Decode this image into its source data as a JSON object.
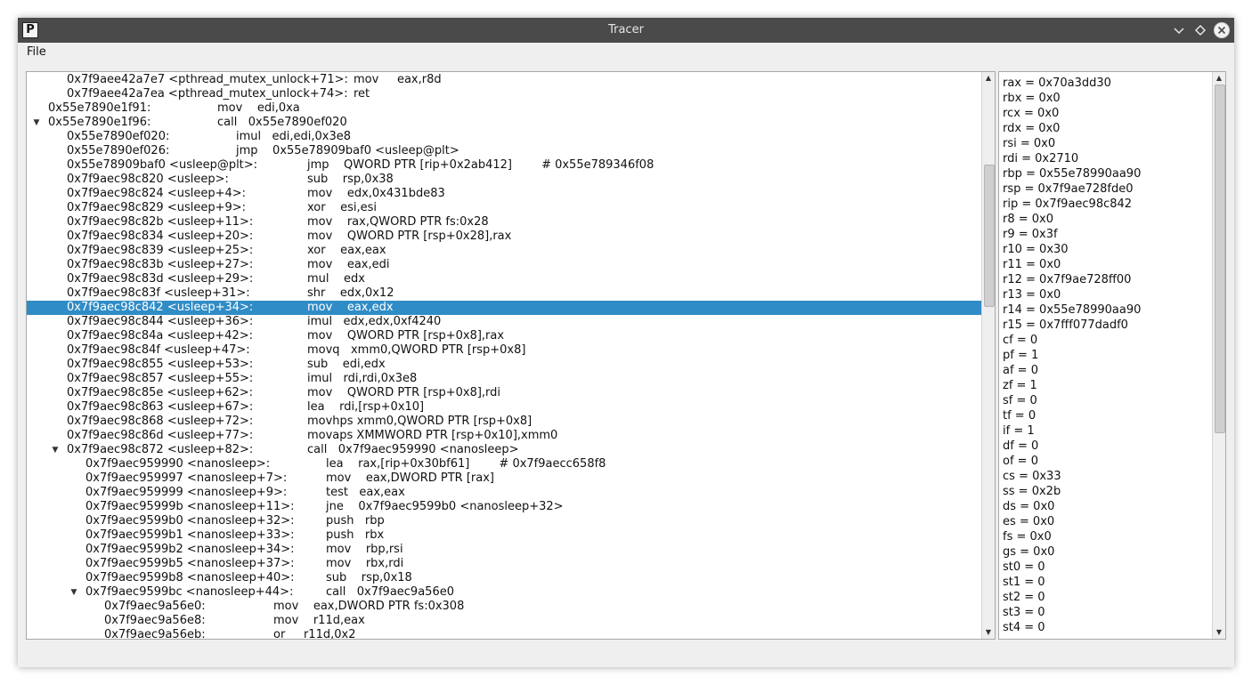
{
  "window": {
    "title": "Tracer",
    "icon_letter": "P",
    "controls": [
      "chevron-down-icon",
      "diamond-icon",
      "close-icon"
    ]
  },
  "menu": {
    "file_label": "File"
  },
  "colors": {
    "selection": "#308cc6",
    "titlebar": "#4a4a4a"
  },
  "trace": {
    "rows": [
      {
        "indent": 1,
        "arrow": "",
        "addr": "0x7f9aee42a7e7 <pthread_mutex_unlock+71>:",
        "instr": "mov     eax,r8d"
      },
      {
        "indent": 1,
        "arrow": "",
        "addr": "0x7f9aee42a7ea <pthread_mutex_unlock+74>:",
        "instr": "ret"
      },
      {
        "indent": 0,
        "arrow": "",
        "addr": "0x55e7890e1f91:",
        "instr": "mov    edi,0xa"
      },
      {
        "indent": 0,
        "arrow": "▼",
        "addr": "0x55e7890e1f96:",
        "instr": "call   0x55e7890ef020"
      },
      {
        "indent": 1,
        "arrow": "",
        "addr": "0x55e7890ef020:",
        "instr": "imul   edi,edi,0x3e8"
      },
      {
        "indent": 1,
        "arrow": "",
        "addr": "0x55e7890ef026:",
        "instr": "jmp    0x55e78909baf0 <usleep@plt>"
      },
      {
        "indent": 1,
        "arrow": "",
        "addr": "0x55e78909baf0 <usleep@plt>:",
        "instr": "jmp    QWORD PTR [rip+0x2ab412]        # 0x55e789346f08"
      },
      {
        "indent": 1,
        "arrow": "",
        "addr": "0x7f9aec98c820 <usleep>:",
        "instr": "sub    rsp,0x38"
      },
      {
        "indent": 1,
        "arrow": "",
        "addr": "0x7f9aec98c824 <usleep+4>:",
        "instr": "mov    edx,0x431bde83"
      },
      {
        "indent": 1,
        "arrow": "",
        "addr": "0x7f9aec98c829 <usleep+9>:",
        "instr": "xor    esi,esi"
      },
      {
        "indent": 1,
        "arrow": "",
        "addr": "0x7f9aec98c82b <usleep+11>:",
        "instr": "mov    rax,QWORD PTR fs:0x28"
      },
      {
        "indent": 1,
        "arrow": "",
        "addr": "0x7f9aec98c834 <usleep+20>:",
        "instr": "mov    QWORD PTR [rsp+0x28],rax"
      },
      {
        "indent": 1,
        "arrow": "",
        "addr": "0x7f9aec98c839 <usleep+25>:",
        "instr": "xor    eax,eax"
      },
      {
        "indent": 1,
        "arrow": "",
        "addr": "0x7f9aec98c83b <usleep+27>:",
        "instr": "mov    eax,edi"
      },
      {
        "indent": 1,
        "arrow": "",
        "addr": "0x7f9aec98c83d <usleep+29>:",
        "instr": "mul    edx"
      },
      {
        "indent": 1,
        "arrow": "",
        "addr": "0x7f9aec98c83f <usleep+31>:",
        "instr": "shr    edx,0x12"
      },
      {
        "indent": 1,
        "arrow": "",
        "addr": "0x7f9aec98c842 <usleep+34>:",
        "instr": "mov    eax,edx",
        "selected": true
      },
      {
        "indent": 1,
        "arrow": "",
        "addr": "0x7f9aec98c844 <usleep+36>:",
        "instr": "imul   edx,edx,0xf4240"
      },
      {
        "indent": 1,
        "arrow": "",
        "addr": "0x7f9aec98c84a <usleep+42>:",
        "instr": "mov    QWORD PTR [rsp+0x8],rax"
      },
      {
        "indent": 1,
        "arrow": "",
        "addr": "0x7f9aec98c84f <usleep+47>:",
        "instr": "movq   xmm0,QWORD PTR [rsp+0x8]"
      },
      {
        "indent": 1,
        "arrow": "",
        "addr": "0x7f9aec98c855 <usleep+53>:",
        "instr": "sub    edi,edx"
      },
      {
        "indent": 1,
        "arrow": "",
        "addr": "0x7f9aec98c857 <usleep+55>:",
        "instr": "imul   rdi,rdi,0x3e8"
      },
      {
        "indent": 1,
        "arrow": "",
        "addr": "0x7f9aec98c85e <usleep+62>:",
        "instr": "mov    QWORD PTR [rsp+0x8],rdi"
      },
      {
        "indent": 1,
        "arrow": "",
        "addr": "0x7f9aec98c863 <usleep+67>:",
        "instr": "lea    rdi,[rsp+0x10]"
      },
      {
        "indent": 1,
        "arrow": "",
        "addr": "0x7f9aec98c868 <usleep+72>:",
        "instr": "movhps xmm0,QWORD PTR [rsp+0x8]"
      },
      {
        "indent": 1,
        "arrow": "",
        "addr": "0x7f9aec98c86d <usleep+77>:",
        "instr": "movaps XMMWORD PTR [rsp+0x10],xmm0"
      },
      {
        "indent": 1,
        "arrow": "▼",
        "addr": "0x7f9aec98c872 <usleep+82>:",
        "instr": "call   0x7f9aec959990 <nanosleep>"
      },
      {
        "indent": 2,
        "arrow": "",
        "addr": "0x7f9aec959990 <nanosleep>:",
        "instr": "lea    rax,[rip+0x30bf61]        # 0x7f9aecc658f8"
      },
      {
        "indent": 2,
        "arrow": "",
        "addr": "0x7f9aec959997 <nanosleep+7>:",
        "instr": "mov    eax,DWORD PTR [rax]"
      },
      {
        "indent": 2,
        "arrow": "",
        "addr": "0x7f9aec959999 <nanosleep+9>:",
        "instr": "test   eax,eax"
      },
      {
        "indent": 2,
        "arrow": "",
        "addr": "0x7f9aec95999b <nanosleep+11>:",
        "instr": "jne    0x7f9aec9599b0 <nanosleep+32>"
      },
      {
        "indent": 2,
        "arrow": "",
        "addr": "0x7f9aec9599b0 <nanosleep+32>:",
        "instr": "push   rbp"
      },
      {
        "indent": 2,
        "arrow": "",
        "addr": "0x7f9aec9599b1 <nanosleep+33>:",
        "instr": "push   rbx"
      },
      {
        "indent": 2,
        "arrow": "",
        "addr": "0x7f9aec9599b2 <nanosleep+34>:",
        "instr": "mov    rbp,rsi"
      },
      {
        "indent": 2,
        "arrow": "",
        "addr": "0x7f9aec9599b5 <nanosleep+37>:",
        "instr": "mov    rbx,rdi"
      },
      {
        "indent": 2,
        "arrow": "",
        "addr": "0x7f9aec9599b8 <nanosleep+40>:",
        "instr": "sub    rsp,0x18"
      },
      {
        "indent": 2,
        "arrow": "▼",
        "addr": "0x7f9aec9599bc <nanosleep+44>:",
        "instr": "call   0x7f9aec9a56e0"
      },
      {
        "indent": 3,
        "arrow": "",
        "addr": "0x7f9aec9a56e0:",
        "instr": "mov    eax,DWORD PTR fs:0x308"
      },
      {
        "indent": 3,
        "arrow": "",
        "addr": "0x7f9aec9a56e8:",
        "instr": "mov    r11d,eax"
      },
      {
        "indent": 3,
        "arrow": "",
        "addr": "0x7f9aec9a56eb:",
        "instr": "or     r11d,0x2"
      }
    ],
    "scroll_fraction": 0.2
  },
  "registers": {
    "rows": [
      "rax = 0x70a3dd30",
      "rbx = 0x0",
      "rcx = 0x0",
      "rdx = 0x0",
      "rsi = 0x0",
      "rdi = 0x2710",
      "rbp = 0x55e78990aa90",
      "rsp = 0x7f9ae728fde0",
      "rip = 0x7f9aec98c842",
      "r8 = 0x0",
      "r9 = 0x3f",
      "r10 = 0x30",
      "r11 = 0x0",
      "r12 = 0x7f9ae728ff00",
      "r13 = 0x0",
      "r14 = 0x55e78990aa90",
      "r15 = 0x7fff077dadf0",
      "cf = 0",
      "pf = 1",
      "af = 0",
      "zf = 1",
      "sf = 0",
      "tf = 0",
      "if = 1",
      "df = 0",
      "of = 0",
      "cs = 0x33",
      "ss = 0x2b",
      "ds = 0x0",
      "es = 0x0",
      "fs = 0x0",
      "gs = 0x0",
      "st0 = 0",
      "st1 = 0",
      "st2 = 0",
      "st3 = 0",
      "st4 = 0"
    ],
    "scroll_fraction": 0.0
  }
}
